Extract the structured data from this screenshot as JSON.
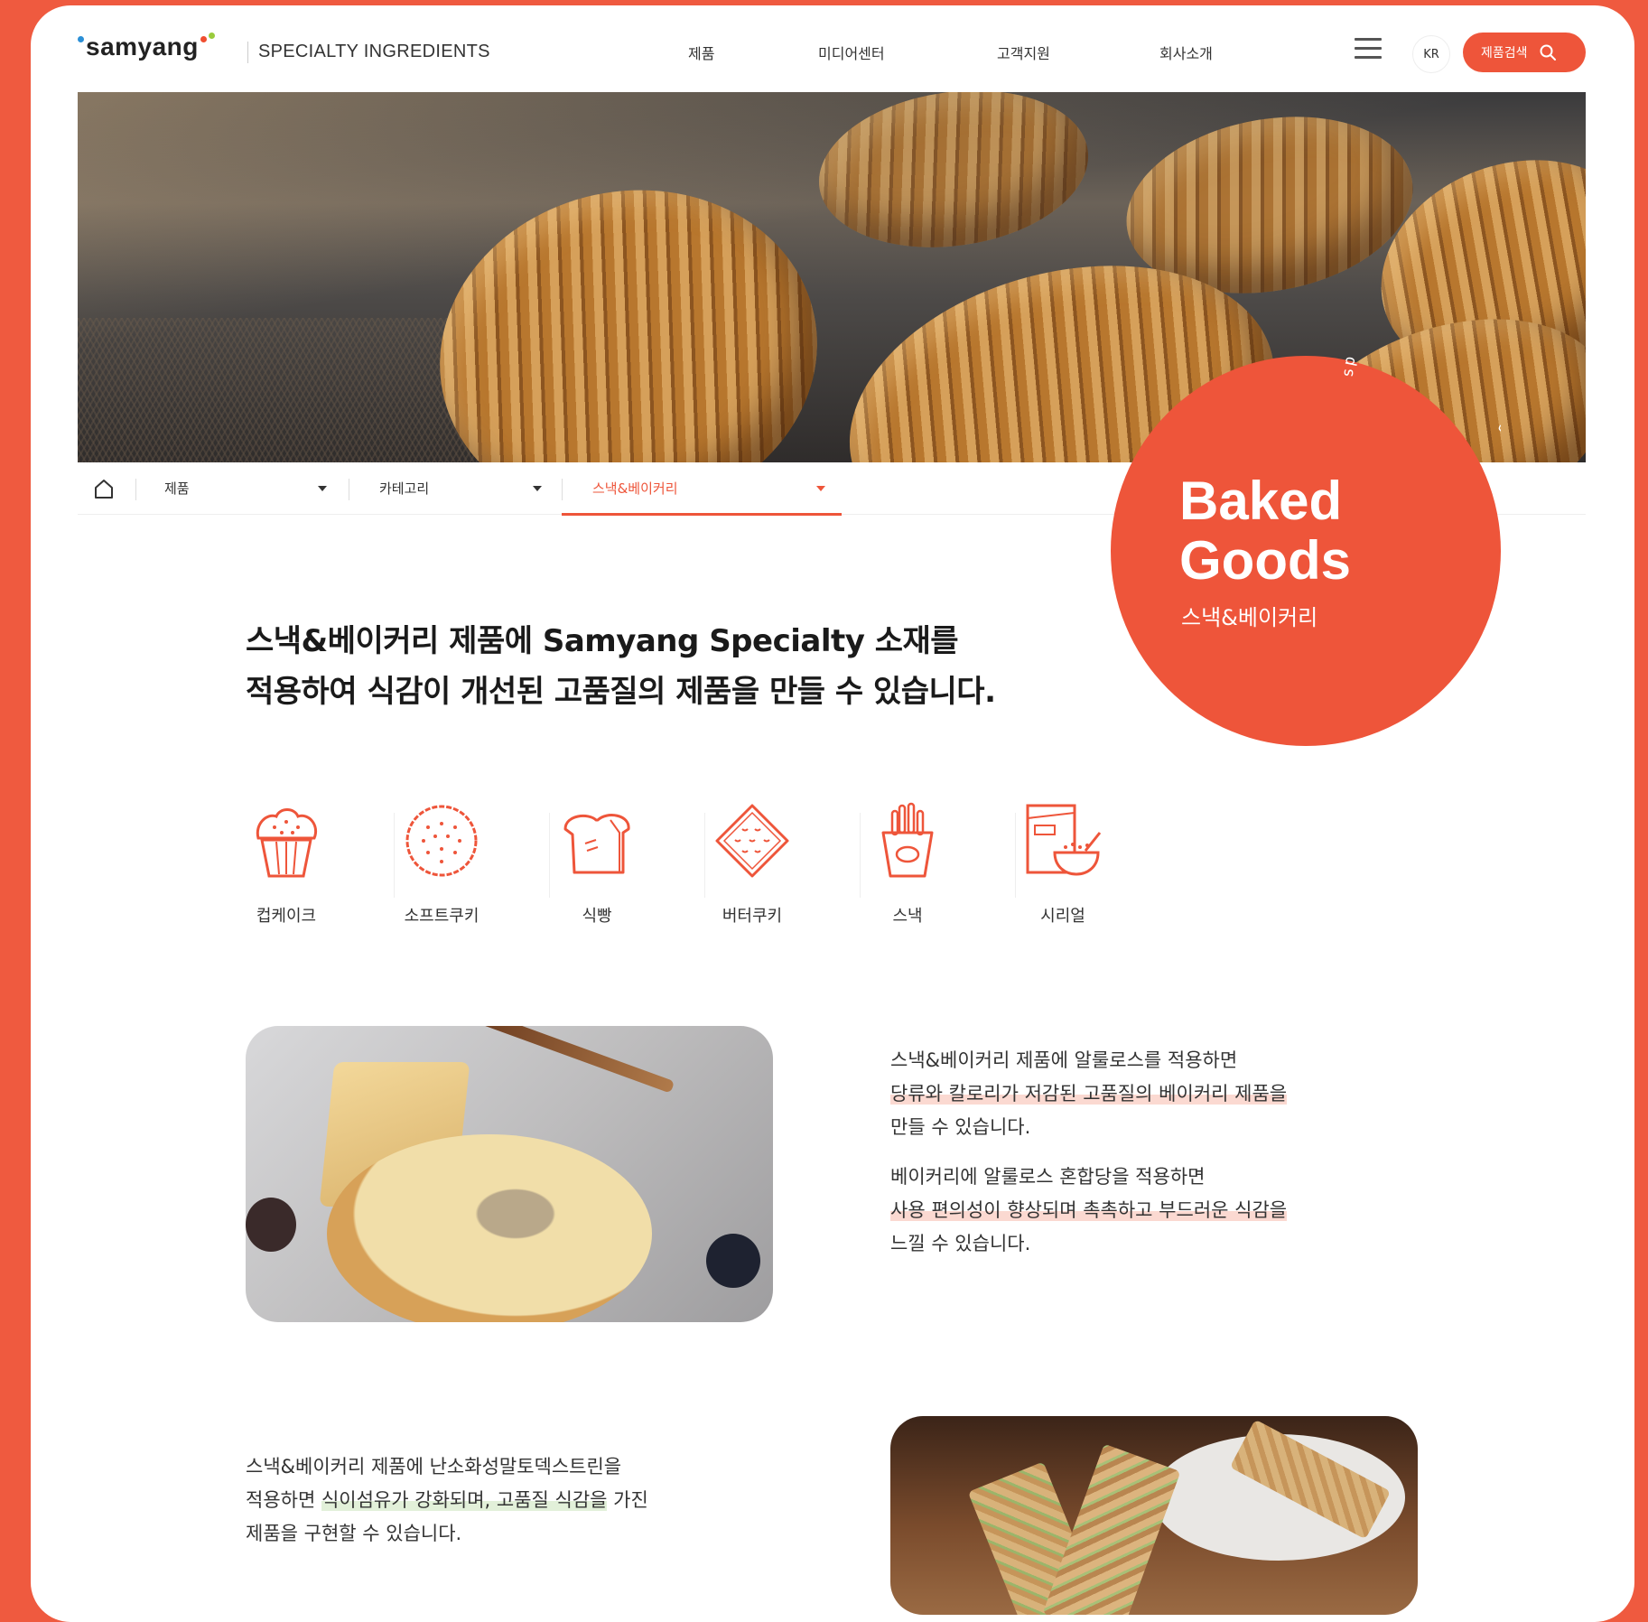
{
  "header": {
    "logo": {
      "text": "samyang",
      "tagline": "SPECIALTY INGREDIENTS"
    },
    "nav": [
      "제품",
      "미디어센터",
      "고객지원",
      "회사소개"
    ],
    "lang": "KR",
    "search_label": "제품검색"
  },
  "breadcrumb": {
    "items": [
      "제품",
      "카테고리",
      "스낵&베이커리"
    ]
  },
  "badge": {
    "title_line1": "Baked",
    "title_line2": "Goods",
    "subtitle": "스낵&베이커리",
    "ring_text": "specialty ingredients samyang"
  },
  "intro": {
    "line1": "스낵&베이커리 제품에 Samyang Specialty 소재를",
    "line2": "적용하여 식감이 개선된 고품질의 제품을 만들 수 있습니다."
  },
  "categories": [
    {
      "label": "컵케이크",
      "icon": "cupcake-icon"
    },
    {
      "label": "소프트쿠키",
      "icon": "cookie-icon"
    },
    {
      "label": "식빵",
      "icon": "bread-icon"
    },
    {
      "label": "버터쿠키",
      "icon": "butter-cookie-icon"
    },
    {
      "label": "스낵",
      "icon": "snack-icon"
    },
    {
      "label": "시리얼",
      "icon": "cereal-icon"
    }
  ],
  "block1": {
    "p1_line1": "스낵&베이커리 제품에 알룰로스를 적용하면",
    "p1_line2": "당류와 칼로리가 저감된 고품질의 베이커리 제품을",
    "p1_line3": "만들 수 있습니다.",
    "p2_line1": "베이커리에 알룰로스 혼합당을 적용하면",
    "p2_line2": "사용 편의성이 향상되며 촉촉하고 부드러운 식감을",
    "p2_line3": "느낄 수 있습니다."
  },
  "block2": {
    "line1": "스낵&베이커리 제품에 난소화성말토덱스트린을",
    "line2a": "적용하면 ",
    "line2b": "식이섬유가 강화되며, 고품질 식감을",
    "line2c": " 가진",
    "line3": "제품을 구현할 수 있습니다."
  },
  "colors": {
    "accent": "#ee553a",
    "background": "#ef5a3f"
  }
}
